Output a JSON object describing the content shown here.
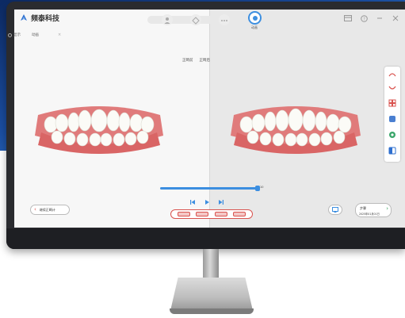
{
  "app": {
    "brand_name": "频泰科技",
    "mode_label": "动画"
  },
  "sub_toolbar": {
    "item_1": "显示",
    "item_2": "动画"
  },
  "compare": {
    "before_label": "正畸前",
    "after_label": "正畸后"
  },
  "timeline": {
    "end_label": "10",
    "progress": 1.0
  },
  "footer": {
    "back_label": "继续正畸计",
    "next_label": "步骤",
    "next_sub_label": "2025年01月01日"
  },
  "colors": {
    "accent_blue": "#3c8ee0",
    "accent_red": "#d9534f",
    "accent_green": "#2e9b55"
  }
}
